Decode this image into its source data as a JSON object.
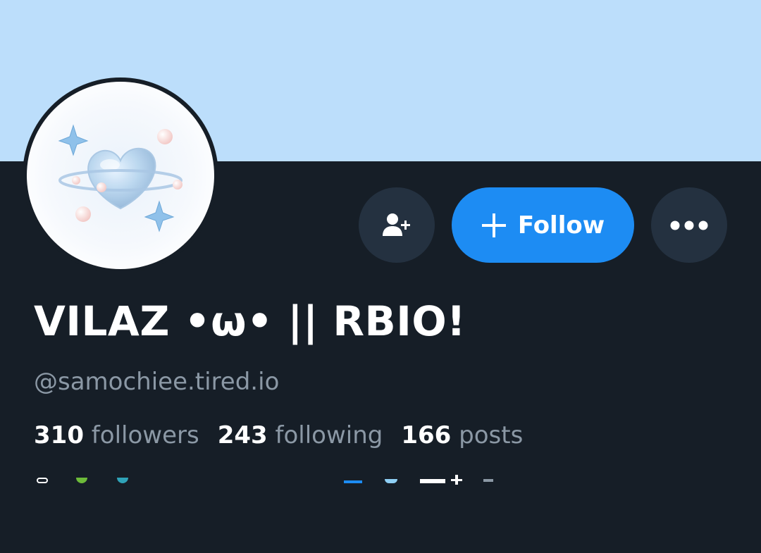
{
  "profile": {
    "display_name": "VILAZ •ω• || RBIO!",
    "handle": "@samochiee.tired.io",
    "avatar_icon": "heart-planet-sparkles"
  },
  "actions": {
    "add_user_icon": "add-user-icon",
    "follow_label": "Follow",
    "follow_icon": "plus-icon",
    "more_icon": "more-icon"
  },
  "stats": [
    {
      "value": "310",
      "label": "followers"
    },
    {
      "value": "243",
      "label": "following"
    },
    {
      "value": "166",
      "label": "posts"
    }
  ],
  "colors": {
    "banner": "#bcdefb",
    "background": "#161e27",
    "accent": "#1d8cf3",
    "secondary_button": "#243140",
    "muted_text": "#8b98a5"
  }
}
